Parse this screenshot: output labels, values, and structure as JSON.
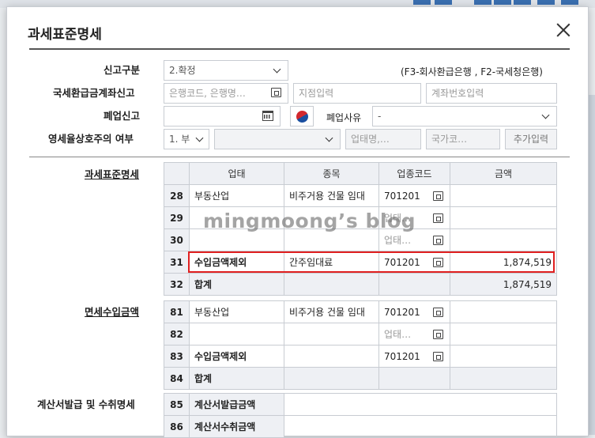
{
  "dialog": {
    "title": "과세표준명세"
  },
  "form": {
    "report_type": {
      "label": "신고구분",
      "value": "2.확정"
    },
    "notice": "(F3-회사환급은행 , F2-국세청은행)",
    "refund_account": {
      "label": "국세환급금계좌신고",
      "bank_placeholder": "은행코드, 은행명…",
      "branch_placeholder": "지점입력",
      "account_placeholder": "계좌번호입력"
    },
    "closure": {
      "label": "폐업신고",
      "reason_label": "폐업사유",
      "reason_value": "-"
    },
    "retail": {
      "label": "영세율상호주의 여부",
      "value": "1. 부",
      "type_placeholder": "업태명,…",
      "country_placeholder": "국가코…",
      "add_button": "추가입력"
    }
  },
  "tax_base": {
    "label": "과세표준명세",
    "headers": [
      "업태",
      "종목",
      "업종코드",
      "금액"
    ],
    "rows": [
      {
        "no": "28",
        "type": "부동산업",
        "item": "비주거용 건물 임대",
        "code": "701201",
        "amount": ""
      },
      {
        "no": "29",
        "type": "",
        "item": "",
        "code": "업태…",
        "amount": ""
      },
      {
        "no": "30",
        "type": "",
        "item": "",
        "code": "업태…",
        "amount": ""
      },
      {
        "no": "31",
        "type": "수입금액제외",
        "item": "간주임대료",
        "code": "701201",
        "amount": "1,874,519"
      }
    ],
    "total": {
      "no": "32",
      "label": "합계",
      "amount": "1,874,519"
    }
  },
  "exempt": {
    "label": "면세수입금액",
    "rows": [
      {
        "no": "81",
        "type": "부동산업",
        "item": "비주거용 건물 임대",
        "code": "701201"
      },
      {
        "no": "82",
        "type": "",
        "item": "",
        "code": "업태…"
      },
      {
        "no": "83",
        "type": "수입금액제외",
        "item": "",
        "code": "701201"
      }
    ],
    "total": {
      "no": "84",
      "label": "합계"
    }
  },
  "invoice": {
    "label": "계산서발급 및 수취명세",
    "rows": [
      {
        "no": "85",
        "label": "계산서발급금액"
      },
      {
        "no": "86",
        "label": "계산서수취금액"
      }
    ]
  },
  "watermark": "mingmoong’s blog",
  "colors": {
    "highlight": "#e02020",
    "header_bg": "#eef0f4",
    "border": "#c8ccd2"
  }
}
